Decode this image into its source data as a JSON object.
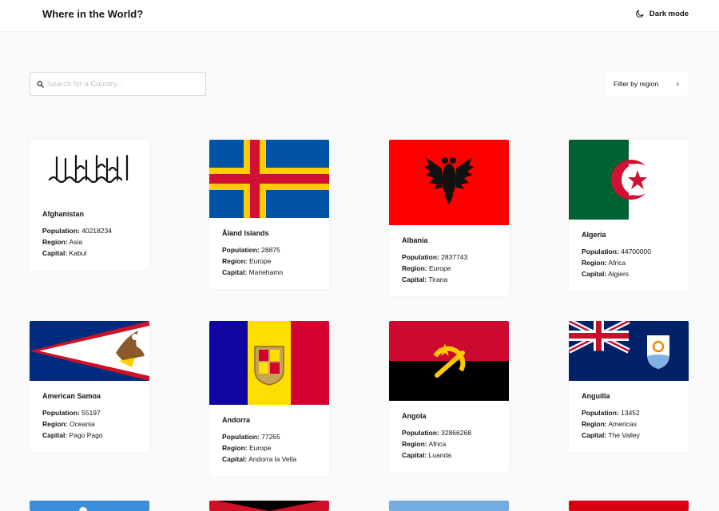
{
  "header": {
    "title": "Where in the World?",
    "dark_mode_label": "Dark mode"
  },
  "search": {
    "placeholder": "Search for a Country..."
  },
  "filter": {
    "label": "Filter by region",
    "chevron": "›"
  },
  "labels": {
    "population": "Population:",
    "region": "Region:",
    "capital": "Capital:"
  },
  "countries": [
    {
      "name": "Afghanistan",
      "population": "40218234",
      "region": "Asia",
      "capital": "Kabul",
      "flag_icon": "afghanistan-flag-icon"
    },
    {
      "name": "Åland Islands",
      "population": "28875",
      "region": "Europe",
      "capital": "Mariehamn",
      "flag_icon": "aland-flag-icon"
    },
    {
      "name": "Albania",
      "population": "2837743",
      "region": "Europe",
      "capital": "Tirana",
      "flag_icon": "albania-flag-icon"
    },
    {
      "name": "Algeria",
      "population": "44700000",
      "region": "Africa",
      "capital": "Algiers",
      "flag_icon": "algeria-flag-icon"
    },
    {
      "name": "American Samoa",
      "population": "55197",
      "region": "Oceania",
      "capital": "Pago Pago",
      "flag_icon": "american-samoa-flag-icon"
    },
    {
      "name": "Andorra",
      "population": "77265",
      "region": "Europe",
      "capital": "Andorra la Vella",
      "flag_icon": "andorra-flag-icon"
    },
    {
      "name": "Angola",
      "population": "32866268",
      "region": "Africa",
      "capital": "Luanda",
      "flag_icon": "angola-flag-icon"
    },
    {
      "name": "Anguilla",
      "population": "13452",
      "region": "Americas",
      "capital": "The Valley",
      "flag_icon": "anguilla-flag-icon"
    }
  ],
  "colors": {
    "background": "#fafafa",
    "card": "#ffffff",
    "text": "#111517"
  }
}
